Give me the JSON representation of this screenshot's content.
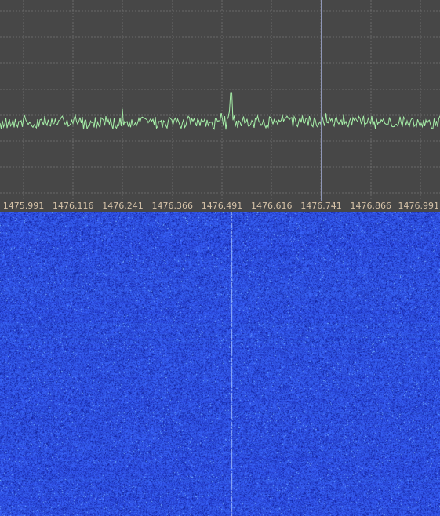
{
  "spectrum": {
    "background_color": "#474747",
    "grid_color": "#6a6a6a",
    "trace_color": "#a6efa8",
    "cursor_color": "#8f96b6",
    "cursor_frequency": "1476.741",
    "peak_frequency": "1476.491"
  },
  "frequency_axis": {
    "label_color": "#d6c3a8",
    "ticks": [
      "1475.991",
      "1476.116",
      "1476.241",
      "1476.366",
      "1476.491",
      "1476.616",
      "1476.741",
      "1476.866",
      "1476.991"
    ]
  },
  "waterfall": {
    "base_color": "#2a47d4",
    "signal_line_color": "#a9c4ff",
    "signal_frequency": "1476.491"
  }
}
